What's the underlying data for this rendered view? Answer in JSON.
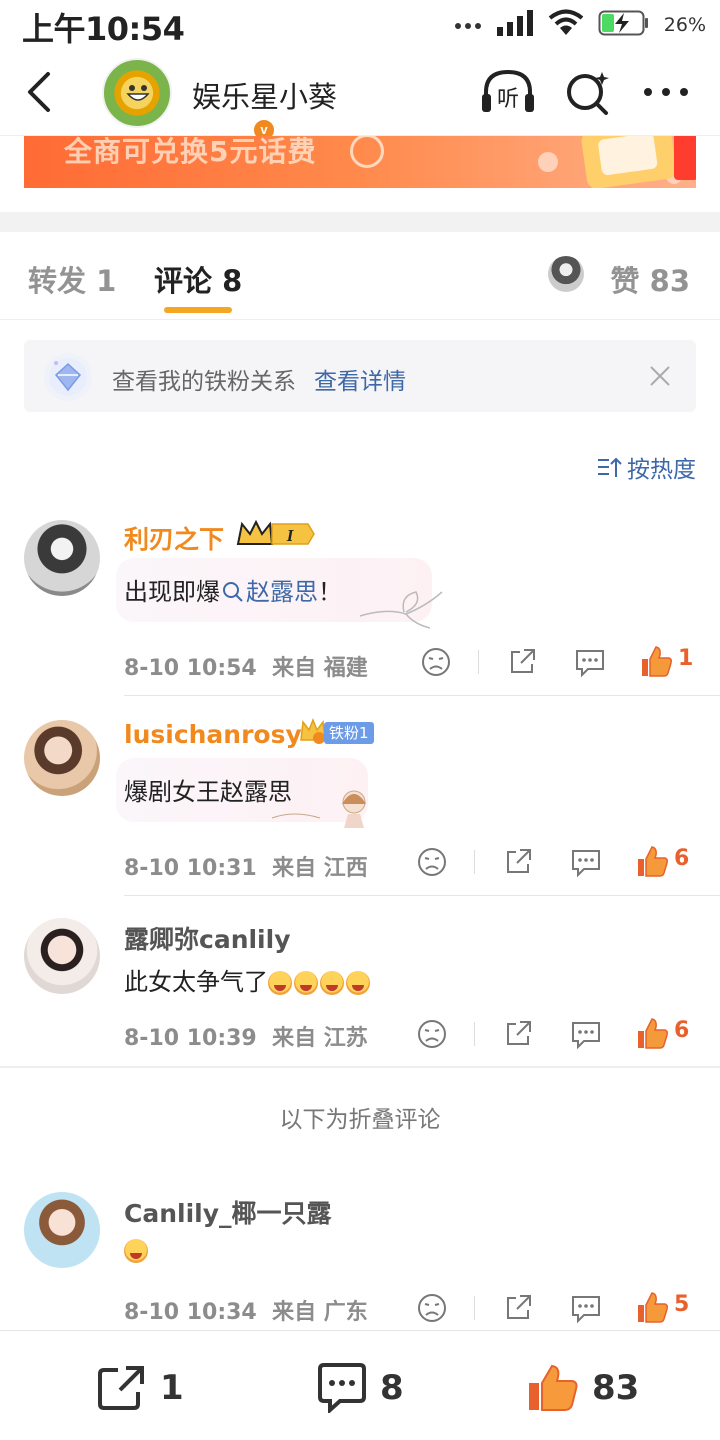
{
  "status_bar": {
    "time": "上午10:54",
    "battery": "26%"
  },
  "header": {
    "title": "娱乐星小葵",
    "listen_label": "听",
    "verified_mark": "v"
  },
  "ad": {
    "text": "全商可兑换5元话费"
  },
  "tabs": {
    "repost": "转发 1",
    "comment": "评论 8",
    "like": "赞 83"
  },
  "fan_notice": {
    "text": "查看我的铁粉关系",
    "link": "查看详情"
  },
  "sort": {
    "label": "按热度"
  },
  "comments": [
    {
      "name": "利刃之下",
      "badge_level": "I",
      "text_prefix": "出现即爆",
      "search_term": "赵露思",
      "text_suffix": "！",
      "time": "8-10 10:54",
      "location": "来自 福建",
      "likes": "1"
    },
    {
      "name": "lusichanrosy",
      "fan_badge": "铁粉1",
      "text": "爆剧女王赵露思",
      "time": "8-10 10:31",
      "location": "来自 江西",
      "likes": "6"
    },
    {
      "name": "露卿弥canlily",
      "text": "此女太争气了",
      "time": "8-10 10:39",
      "location": "来自 江苏",
      "likes": "6"
    }
  ],
  "folded": {
    "label": "以下为折叠评论",
    "comment": {
      "name": "Canlily_椰一只露",
      "time": "8-10 10:34",
      "location": "来自 广东",
      "likes": "5"
    }
  },
  "bottom_bar": {
    "reposts": "1",
    "comments": "8",
    "likes": "83"
  },
  "colors": {
    "accent": "#f5a623",
    "link": "#3e69a8",
    "like": "#e8612c",
    "name_orange": "#f18a1e"
  }
}
